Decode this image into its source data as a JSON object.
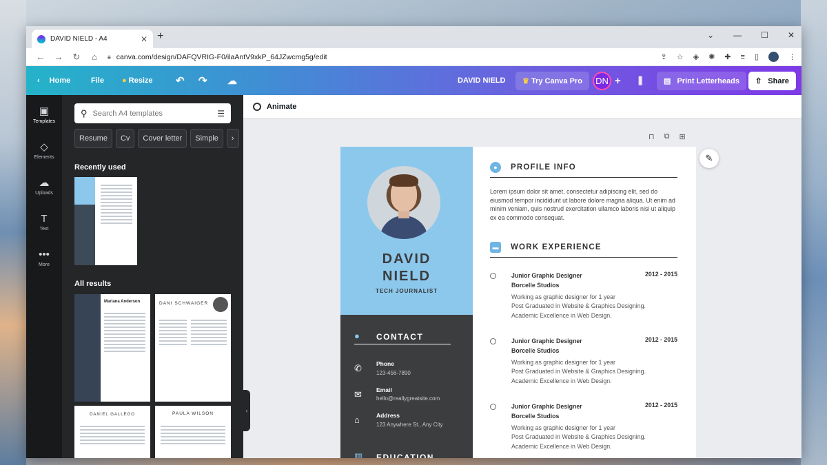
{
  "browser": {
    "tab_title": "DAVID NIELD - A4",
    "url": "canva.com/design/DAFQVRIG-F0/ilaAntV9xkP_64JZwcmg5g/edit"
  },
  "topbar": {
    "home": "Home",
    "file": "File",
    "resize": "Resize",
    "doc_title": "DAVID NIELD",
    "try_pro": "Try Canva Pro",
    "avatar_initials": "DN",
    "print": "Print Letterheads",
    "share": "Share"
  },
  "rail": {
    "items": [
      {
        "label": "Templates",
        "icon": "templates-icon"
      },
      {
        "label": "Elements",
        "icon": "elements-icon"
      },
      {
        "label": "Uploads",
        "icon": "uploads-icon"
      },
      {
        "label": "Text",
        "icon": "text-icon"
      },
      {
        "label": "More",
        "icon": "more-icon"
      }
    ]
  },
  "panel": {
    "search_placeholder": "Search A4 templates",
    "chips": [
      "Resume",
      "Cv",
      "Cover letter",
      "Simple"
    ],
    "recently_used": "Recently used",
    "all_results": "All results",
    "results": [
      {
        "name": "Mariana Anderson"
      },
      {
        "name": "DANI SCHWAIGER"
      },
      {
        "name": "DANIEL GALLEGO"
      },
      {
        "name": "PAULA WILSON"
      }
    ]
  },
  "toolbar": {
    "animate": "Animate"
  },
  "resume": {
    "first_name": "DAVID",
    "last_name": "NIELD",
    "role": "TECH JOURNALIST",
    "contact_title": "CONTACT",
    "contacts": [
      {
        "label": "Phone",
        "value": "123-456-7890",
        "icon": "phone-icon"
      },
      {
        "label": "Email",
        "value": "hello@reallygreatsite.com",
        "icon": "email-icon"
      },
      {
        "label": "Address",
        "value": "123 Anywhere St., Any City",
        "icon": "home-icon"
      }
    ],
    "education_title": "EDUCATION",
    "profile_title": "PROFILE INFO",
    "profile_text": "Lorem ipsum dolor sit amet, consectetur adipiscing elit, sed do eiusmod tempor incididunt ut labore dolore magna aliqua. Ut enim ad minim veniam, quis nostrud exercitation ullamco laboris nisi ut aliquip ex ea commodo consequat.",
    "work_title": "WORK EXPERIENCE",
    "jobs": [
      {
        "title": "Junior Graphic Designer",
        "company": "Borcelle Studios",
        "years": "2012 - 2015",
        "lines": [
          "Working as graphic designer for 1 year",
          "Post Graduated in Website & Graphics Designing.",
          "Academic Excellence in Web Design."
        ]
      },
      {
        "title": "Junior Graphic Designer",
        "company": "Borcelle Studios",
        "years": "2012 - 2015",
        "lines": [
          "Working as graphic designer for 1 year",
          "Post Graduated in Website & Graphics Designing.",
          "Academic Excellence in Web Design."
        ]
      },
      {
        "title": "Junior Graphic Designer",
        "company": "Borcelle Studios",
        "years": "2012 - 2015",
        "lines": [
          "Working as graphic designer for 1 year",
          "Post Graduated in Website & Graphics Designing.",
          "Academic Excellence in Web Design."
        ]
      }
    ]
  },
  "colors": {
    "accent_light_blue": "#8cc8ec",
    "dark_panel": "#3c3d3f",
    "canva_purple": "#7d3ae6"
  }
}
